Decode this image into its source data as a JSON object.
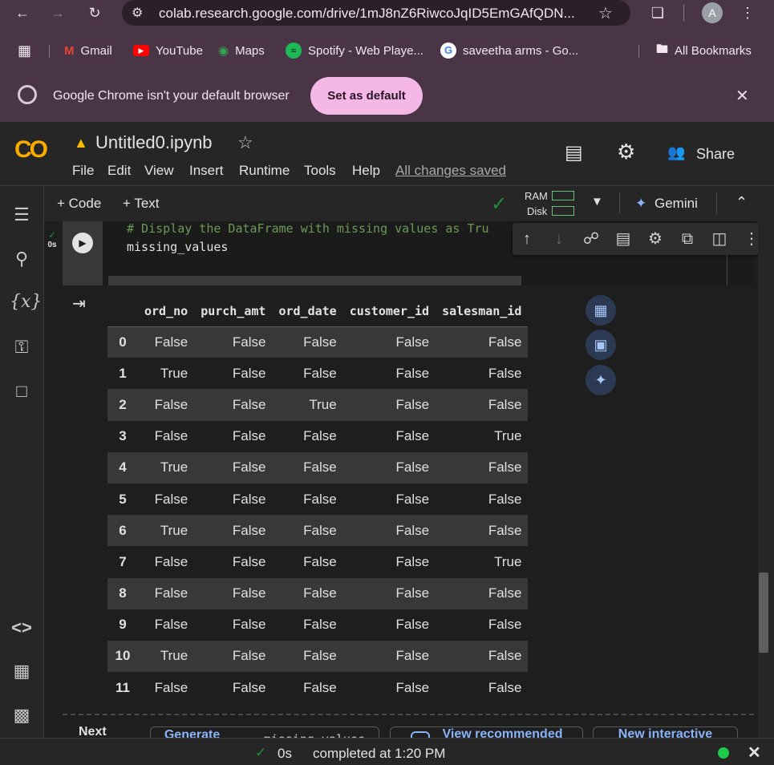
{
  "browser": {
    "url": "colab.research.google.com/drive/1mJ8nZ6RiwcoJqID5EmGAfQDN...",
    "profile_initial": "A",
    "bookmarks": [
      {
        "label": "Gmail",
        "icon": "gmail-icon"
      },
      {
        "label": "YouTube",
        "icon": "youtube-icon"
      },
      {
        "label": "Maps",
        "icon": "maps-icon"
      },
      {
        "label": "Spotify - Web Playe...",
        "icon": "spotify-icon"
      },
      {
        "label": "saveetha arms - Go...",
        "icon": "google-icon"
      }
    ],
    "all_bookmarks": "All Bookmarks",
    "infobar_message": "Google Chrome isn't your default browser",
    "set_default_label": "Set as default"
  },
  "colab": {
    "logo": "CO",
    "notebook_title": "Untitled0.ipynb",
    "menu": [
      "File",
      "Edit",
      "View",
      "Insert",
      "Runtime",
      "Tools",
      "Help"
    ],
    "save_status": "All changes saved",
    "share_label": "Share",
    "toolbar": {
      "add_code": "+ Code",
      "add_text": "+ Text",
      "ram_label": "RAM",
      "disk_label": "Disk",
      "gemini_label": "Gemini"
    },
    "cell": {
      "exec_time": "0s",
      "comment_line": "# Display the DataFrame with missing values as Tru",
      "code_line": "missing_values"
    },
    "dataframe": {
      "columns": [
        "ord_no",
        "purch_amt",
        "ord_date",
        "customer_id",
        "salesman_id"
      ],
      "rows": [
        {
          "idx": "0",
          "cells": [
            "False",
            "False",
            "False",
            "False",
            "False"
          ]
        },
        {
          "idx": "1",
          "cells": [
            "True",
            "False",
            "False",
            "False",
            "False"
          ]
        },
        {
          "idx": "2",
          "cells": [
            "False",
            "False",
            "True",
            "False",
            "False"
          ]
        },
        {
          "idx": "3",
          "cells": [
            "False",
            "False",
            "False",
            "False",
            "True"
          ]
        },
        {
          "idx": "4",
          "cells": [
            "True",
            "False",
            "False",
            "False",
            "False"
          ]
        },
        {
          "idx": "5",
          "cells": [
            "False",
            "False",
            "False",
            "False",
            "False"
          ]
        },
        {
          "idx": "6",
          "cells": [
            "True",
            "False",
            "False",
            "False",
            "False"
          ]
        },
        {
          "idx": "7",
          "cells": [
            "False",
            "False",
            "False",
            "False",
            "True"
          ]
        },
        {
          "idx": "8",
          "cells": [
            "False",
            "False",
            "False",
            "False",
            "False"
          ]
        },
        {
          "idx": "9",
          "cells": [
            "False",
            "False",
            "False",
            "False",
            "False"
          ]
        },
        {
          "idx": "10",
          "cells": [
            "True",
            "False",
            "False",
            "False",
            "False"
          ]
        },
        {
          "idx": "11",
          "cells": [
            "False",
            "False",
            "False",
            "False",
            "False"
          ]
        }
      ]
    },
    "next_steps": {
      "label": "Next",
      "buttons": [
        "Generate",
        "missing_values",
        "View recommended",
        "New interactive"
      ]
    },
    "status": {
      "time": "0s",
      "message": "completed at 1:20 PM"
    }
  },
  "colors": {
    "browser_frame": "#4a3547",
    "set_default_bg": "#f5b8e6",
    "colab_orange": "#f9ab00",
    "link_blue": "#8ab4f8",
    "success_green": "#1e8e3e",
    "comment_green": "#6a9955"
  }
}
